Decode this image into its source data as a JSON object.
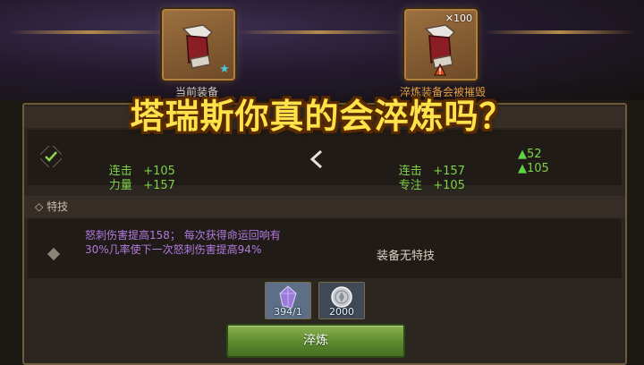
{
  "slots": {
    "current_label": "当前装备",
    "new_label": "淬炼装备会被摧毁",
    "new_count": "100"
  },
  "title_overlay": "塔瑞斯你真的会淬炼吗？",
  "stats": {
    "current": [
      {
        "name": "连击",
        "value": "+105"
      },
      {
        "name": "力量",
        "value": "+157"
      }
    ],
    "new": [
      {
        "name": "连击",
        "value": "+157",
        "increase": "52"
      },
      {
        "name": "专注",
        "value": "+105",
        "increase": "105"
      }
    ]
  },
  "skills": {
    "header": "特技",
    "current_text": "怒刺伤害提高158； 每次获得命运回响有30%几率使下一次怒刺伤害提高94%",
    "new_text": "装备无特技"
  },
  "costs": [
    {
      "icon": "crystal-icon",
      "value": "394/1"
    },
    {
      "icon": "silver-coin-icon",
      "value": "2000"
    }
  ],
  "forge_button": "淬炼",
  "colors": {
    "title": "#ffe14a",
    "stat_green": "#7ed24a",
    "skill_purple": "#b27ae0",
    "button_green": "#5b8a2e"
  }
}
